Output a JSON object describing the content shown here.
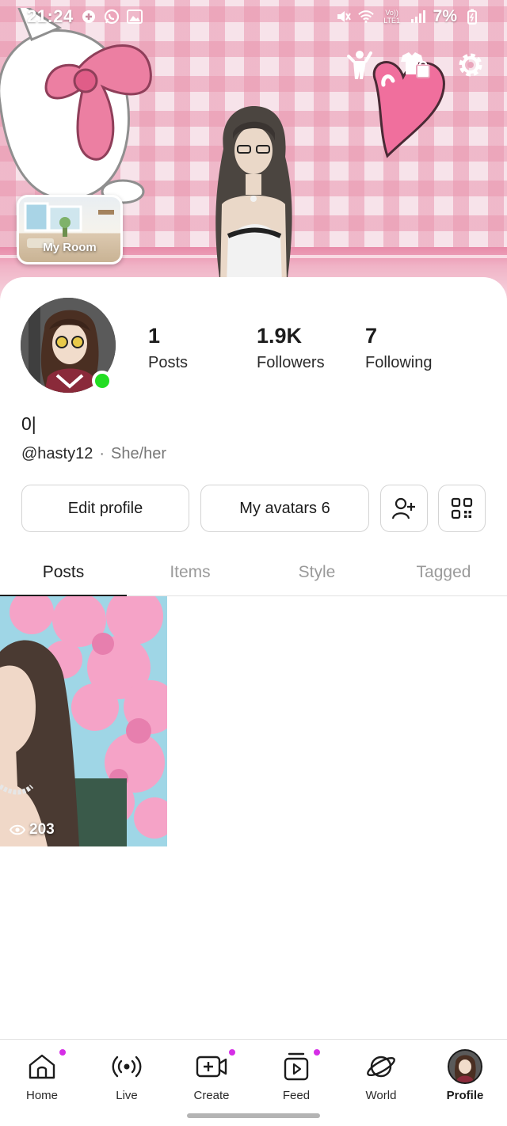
{
  "status_bar": {
    "time": "21:24",
    "network_label": "Vo)) LTE1",
    "battery": "7%"
  },
  "banner": {
    "my_room_label": "My Room"
  },
  "profile": {
    "stats": [
      {
        "value": "1",
        "label": "Posts"
      },
      {
        "value": "1.9K",
        "label": "Followers"
      },
      {
        "value": "7",
        "label": "Following"
      }
    ],
    "display_name": "0|",
    "handle": "@hasty12",
    "separator": "·",
    "pronouns": "She/her",
    "online": true
  },
  "actions": {
    "edit_profile": "Edit profile",
    "my_avatars": "My avatars 6"
  },
  "tabs": [
    "Posts",
    "Items",
    "Style",
    "Tagged"
  ],
  "active_tab": "Posts",
  "posts": [
    {
      "views": "203"
    }
  ],
  "nav": {
    "items": [
      {
        "label": "Home",
        "icon": "home-icon",
        "dot": true
      },
      {
        "label": "Live",
        "icon": "live-icon",
        "dot": false
      },
      {
        "label": "Create",
        "icon": "create-icon",
        "dot": true
      },
      {
        "label": "Feed",
        "icon": "feed-icon",
        "dot": true
      },
      {
        "label": "World",
        "icon": "world-icon",
        "dot": false
      },
      {
        "label": "Profile",
        "icon": "profile-avatar",
        "dot": false
      }
    ],
    "active": "Profile"
  },
  "colors": {
    "online": "#22dd22",
    "notification_dot": "#d52ee6",
    "banner_pink": "#e88aa9"
  }
}
